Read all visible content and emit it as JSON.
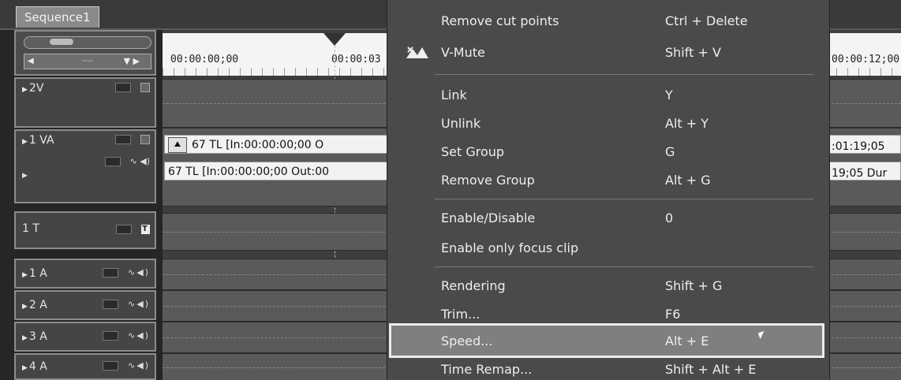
{
  "sequence_tab": {
    "label": "Sequence1"
  },
  "timeline": {
    "timecodes": [
      "00:00:00;00",
      "00:00:03",
      "00:00:12;00"
    ],
    "clip_vid_label": "67  TL [In:00:00:00;00 O",
    "clip_aud_label": "67  TL [In:00:00:00;00 Out:00",
    "clip_vid_right": ":01:19;05",
    "clip_aud_right": "19;05 Dur"
  },
  "tracks": [
    {
      "name": "2V"
    },
    {
      "name": "1 VA"
    },
    {
      "name": "1 T"
    },
    {
      "name": "1 A"
    },
    {
      "name": "2 A"
    },
    {
      "name": "3 A"
    },
    {
      "name": "4 A"
    }
  ],
  "menu": {
    "items": [
      {
        "label": "Remove cut points",
        "shortcut": "Ctrl + Delete"
      },
      {
        "label": "V-Mute",
        "shortcut": "Shift + V",
        "icon": "v-mute-icon"
      },
      {
        "label": "Link",
        "shortcut": "Y"
      },
      {
        "label": "Unlink",
        "shortcut": "Alt + Y"
      },
      {
        "label": "Set Group",
        "shortcut": "G"
      },
      {
        "label": "Remove Group",
        "shortcut": "Alt + G"
      },
      {
        "label": "Enable/Disable",
        "shortcut": "0"
      },
      {
        "label": "Enable only focus clip",
        "shortcut": ""
      },
      {
        "label": "Rendering",
        "shortcut": "Shift + G"
      },
      {
        "label": "Trim...",
        "shortcut": "F6"
      },
      {
        "label": "Speed...",
        "shortcut": "Alt + E",
        "highlighted": true
      },
      {
        "label": "Time Remap...",
        "shortcut": "Shift + Alt + E"
      }
    ]
  },
  "colors": {
    "menu_bg": "#4a4a4a",
    "highlight_bg": "#7f7f7f",
    "highlight_border": "#ececec"
  }
}
